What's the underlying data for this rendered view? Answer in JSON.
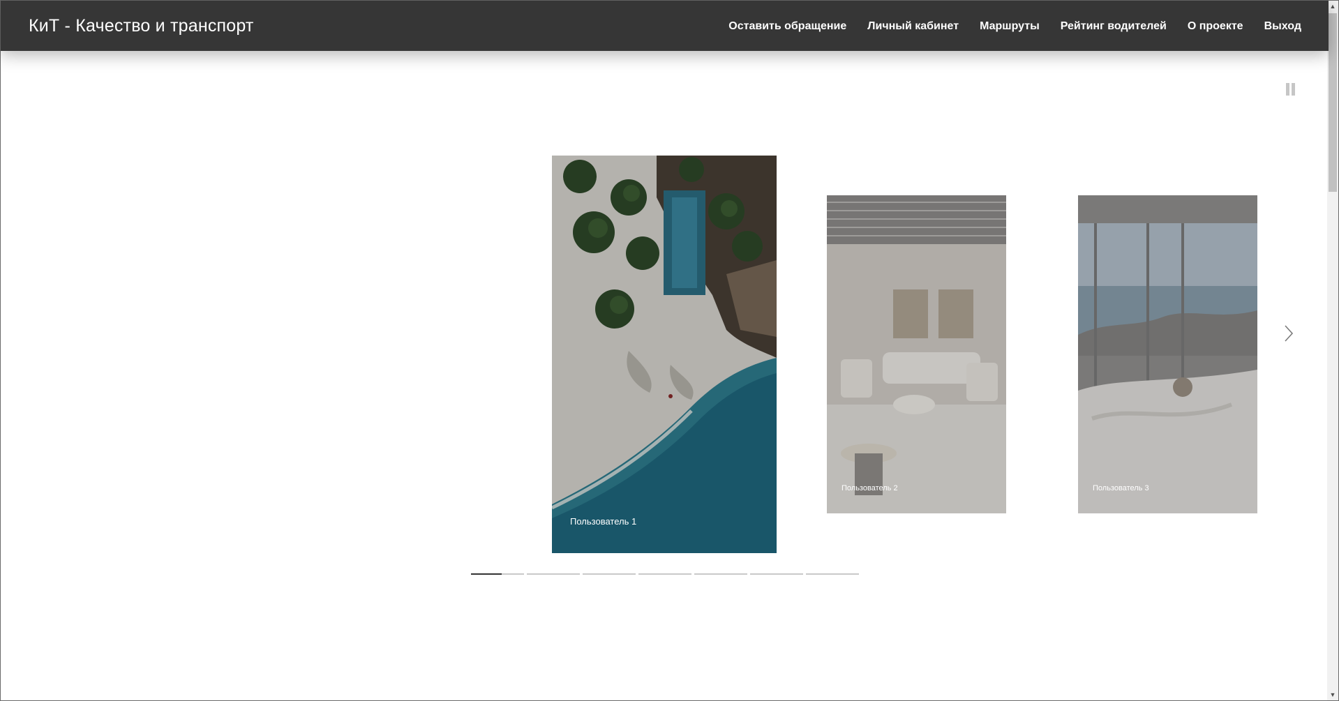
{
  "header": {
    "brand": "КиТ - Качество и транспорт",
    "nav": [
      {
        "label": "Оставить обращение"
      },
      {
        "label": "Личный кабинет"
      },
      {
        "label": "Маршруты"
      },
      {
        "label": "Рейтинг водителей"
      },
      {
        "label": "О проекте"
      },
      {
        "label": "Выход"
      }
    ]
  },
  "slider": {
    "slides": [
      {
        "caption": "Пользователь 1",
        "image": "aerial beach resort with palms and pool"
      },
      {
        "caption": "Пользователь 2",
        "image": "lounge interior with sofa and armchairs"
      },
      {
        "caption": "Пользователь 3",
        "image": "bedroom with window view of the sea"
      }
    ],
    "active_index": 0,
    "pause_icon": "pause-icon",
    "next_icon": "chevron-right-icon",
    "dots_count": 7,
    "active_dot_progress": 0.58
  },
  "colors": {
    "header_bg": "#363636",
    "dot_active": "#333333",
    "dot_inactive": "#c9c9c9"
  }
}
